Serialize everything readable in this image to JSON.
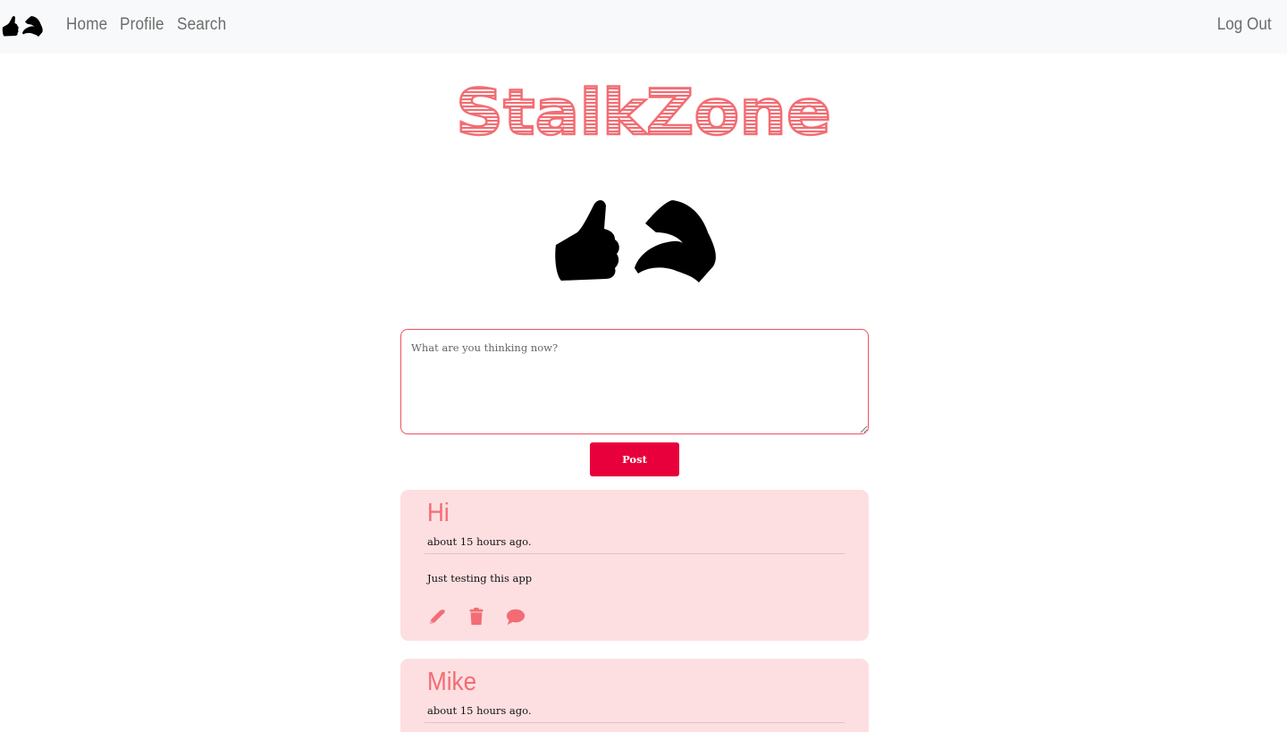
{
  "nav": {
    "home": "Home",
    "profile": "Profile",
    "search": "Search",
    "logout": "Log Out"
  },
  "brand": {
    "title": "StalkZone",
    "accent_color": "#f26d73"
  },
  "composer": {
    "placeholder": "What are you thinking now?",
    "value": "",
    "post_label": "Post",
    "button_color": "#e8003c"
  },
  "posts": [
    {
      "author": "Hi",
      "time": "about 15 hours ago.",
      "body": "Just testing this app",
      "actions": [
        "edit-icon",
        "trash-icon",
        "comment-icon"
      ]
    },
    {
      "author": "Mike",
      "time": "about 15 hours ago."
    }
  ],
  "icons": {
    "logo": "hands-logo-icon",
    "edit": "edit-icon",
    "delete": "trash-icon",
    "comment": "comment-icon"
  }
}
